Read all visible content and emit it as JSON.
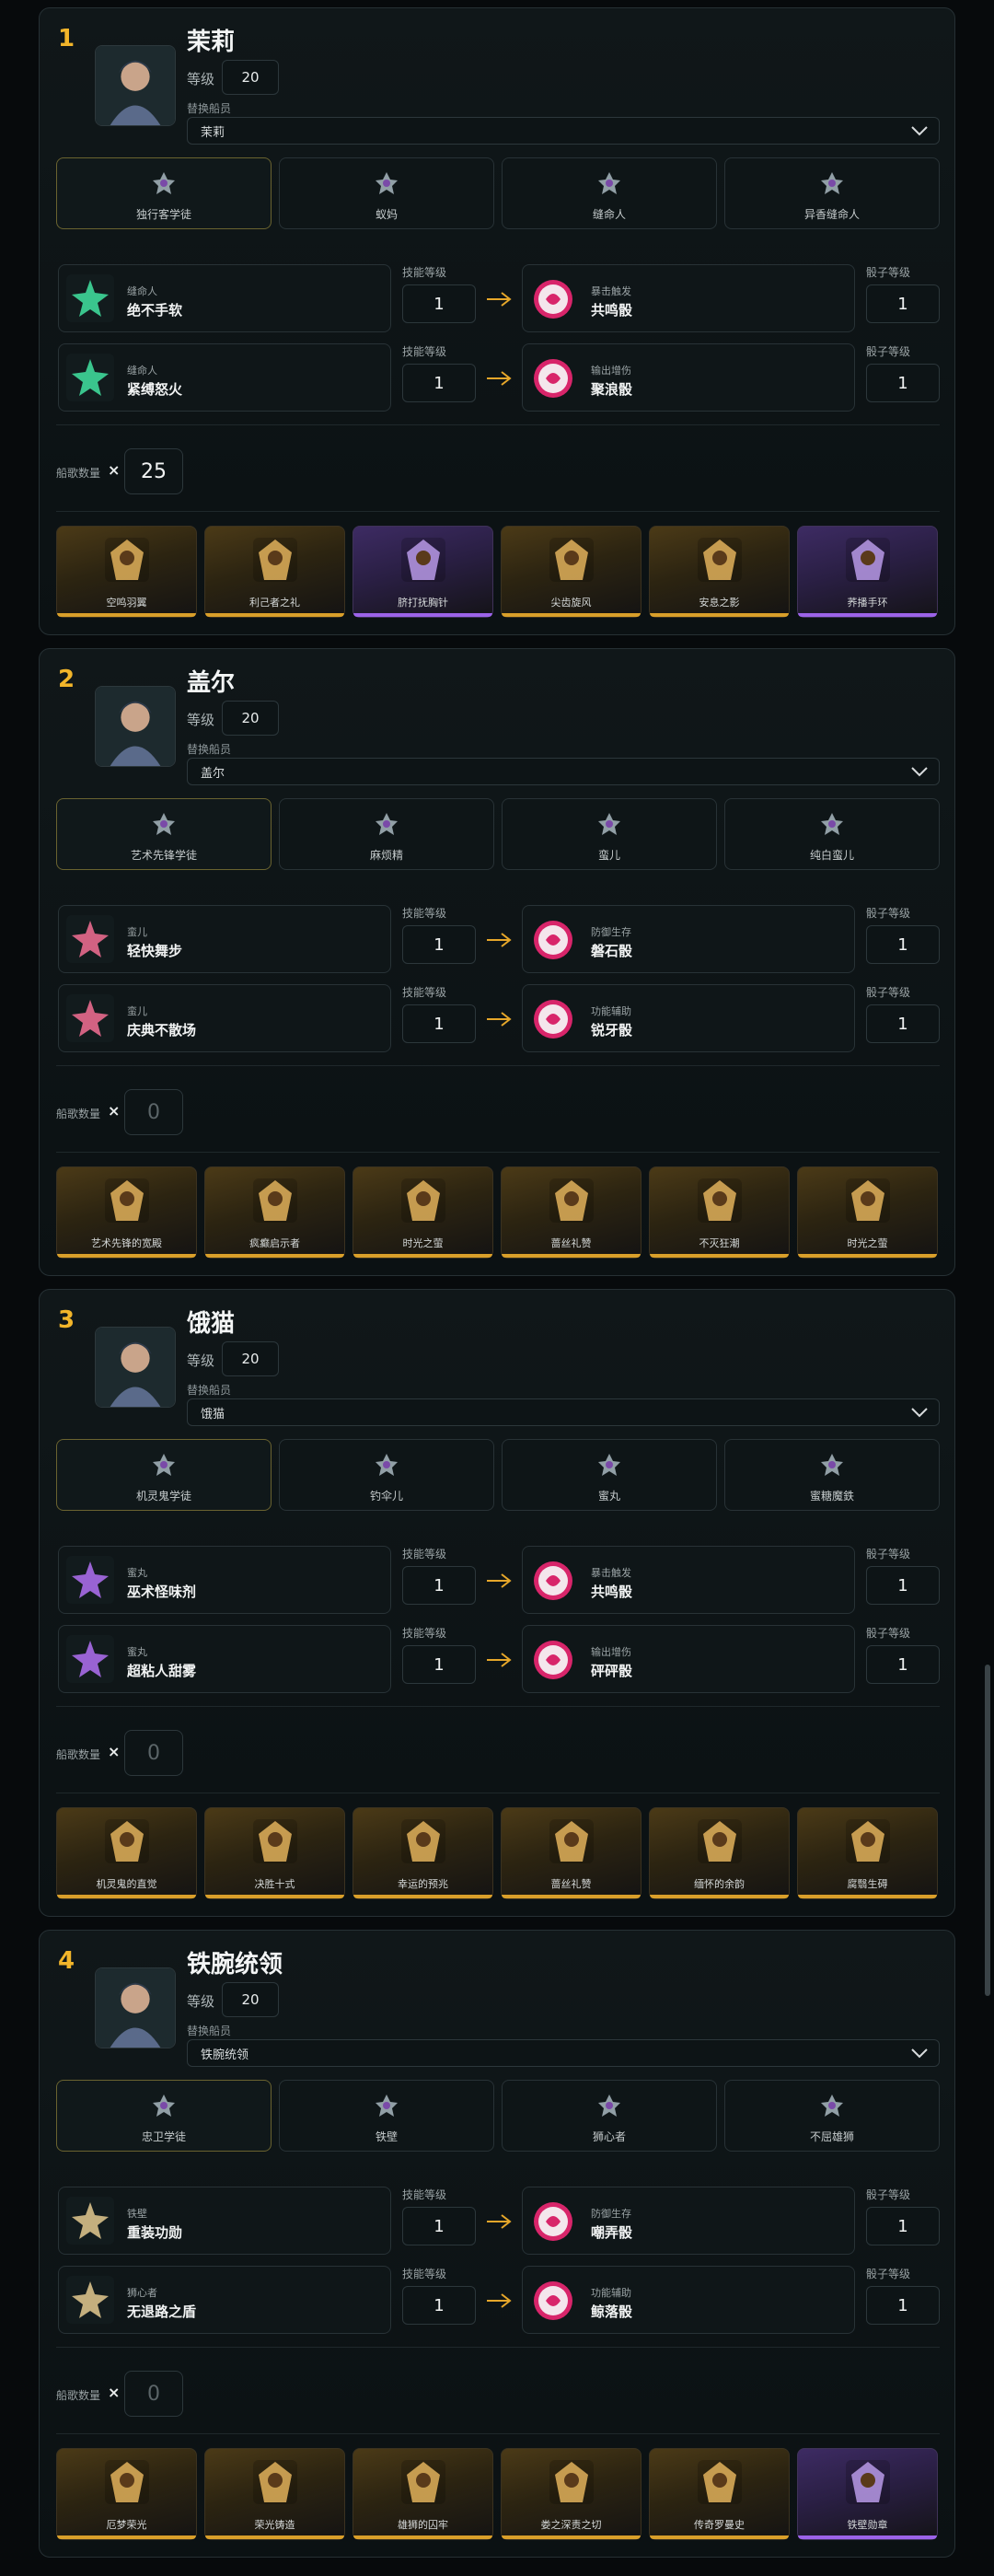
{
  "labels": {
    "level": "等级",
    "swap": "替换船员",
    "skill_level": "技能等级",
    "dice_level": "骰子等级",
    "tune_count": "船歌数量",
    "times": "×"
  },
  "colors": {
    "accent_gold": "#f2b52a",
    "gold_bar": "#d99f2a",
    "purple_bar": "#9c63e8",
    "dice_pink": "#d8256a"
  },
  "cards": [
    {
      "index": "1",
      "name": "茉莉",
      "level": "20",
      "swap_value": "茉莉",
      "tabs": [
        "独行客学徒",
        "蚁妈",
        "缝命人",
        "异香缝命人"
      ],
      "active_tab": 0,
      "skills": [
        {
          "type": "缝命人",
          "name": "绝不手软",
          "skill_level": "1",
          "dice_type": "暴击触发",
          "dice_name": "共鸣骰",
          "dice_level": "1",
          "icon": "green-star-icon",
          "dice_icon": "spiral-dice-icon"
        },
        {
          "type": "缝命人",
          "name": "紧缚怒火",
          "skill_level": "1",
          "dice_type": "输出增伤",
          "dice_name": "聚浪骰",
          "dice_level": "1",
          "icon": "green-star-icon",
          "dice_icon": "wave-dice-icon"
        }
      ],
      "tune_count": "25",
      "tune_filled": true,
      "items": [
        {
          "label": "空鸣羽翼",
          "rarity": "gold",
          "icon": "wing-icon"
        },
        {
          "label": "利己者之礼",
          "rarity": "gold",
          "icon": "helmet-icon"
        },
        {
          "label": "脐打抚胸针",
          "rarity": "purple",
          "icon": "brooch-icon"
        },
        {
          "label": "尖齿旋风",
          "rarity": "gold",
          "icon": "claw-icon"
        },
        {
          "label": "安息之影",
          "rarity": "gold",
          "icon": "mask-icon"
        },
        {
          "label": "荞播手环",
          "rarity": "purple",
          "icon": "bracelet-icon"
        }
      ]
    },
    {
      "index": "2",
      "name": "盖尔",
      "level": "20",
      "swap_value": "盖尔",
      "tabs": [
        "艺术先锋学徒",
        "麻烦精",
        "蛮儿",
        "纯白蛮儿"
      ],
      "active_tab": 0,
      "skills": [
        {
          "type": "蛮儿",
          "name": "轻快舞步",
          "skill_level": "1",
          "dice_type": "防御生存",
          "dice_name": "磐石骰",
          "dice_level": "1",
          "icon": "pink-swirl-icon",
          "dice_icon": "rock-dice-icon"
        },
        {
          "type": "蛮儿",
          "name": "庆典不散场",
          "skill_level": "1",
          "dice_type": "功能辅助",
          "dice_name": "锐牙骰",
          "dice_level": "1",
          "icon": "pink-swirl-icon",
          "dice_icon": "fang-dice-icon"
        }
      ],
      "tune_count": "0",
      "tune_filled": false,
      "items": [
        {
          "label": "艺术先锋的宽殿",
          "rarity": "gold",
          "icon": "angel-icon"
        },
        {
          "label": "疯癫启示者",
          "rarity": "gold",
          "icon": "ship-icon"
        },
        {
          "label": "时光之萤",
          "rarity": "gold",
          "icon": "compass-icon"
        },
        {
          "label": "蔷丝礼赞",
          "rarity": "gold",
          "icon": "cloak-icon"
        },
        {
          "label": "不灭狂潮",
          "rarity": "gold",
          "icon": "beast-icon"
        },
        {
          "label": "时光之萤",
          "rarity": "gold",
          "icon": "compass-icon"
        }
      ]
    },
    {
      "index": "3",
      "name": "饿猫",
      "level": "20",
      "swap_value": "饿猫",
      "tabs": [
        "机灵鬼学徒",
        "钓伞儿",
        "蜜丸",
        "蜜糖魔鉄"
      ],
      "active_tab": 0,
      "skills": [
        {
          "type": "蜜丸",
          "name": "巫术怪味剂",
          "skill_level": "1",
          "dice_type": "暴击触发",
          "dice_name": "共鸣骰",
          "dice_level": "1",
          "icon": "purple-gear-icon",
          "dice_icon": "spiral-dice-icon"
        },
        {
          "type": "蜜丸",
          "name": "超粘人甜雾",
          "skill_level": "1",
          "dice_type": "输出增伤",
          "dice_name": "砰砰骰",
          "dice_level": "1",
          "icon": "purple-wand-icon",
          "dice_icon": "burst-dice-icon"
        }
      ],
      "tune_count": "0",
      "tune_filled": false,
      "items": [
        {
          "label": "机灵鬼的直觉",
          "rarity": "gold",
          "icon": "gun-icon"
        },
        {
          "label": "决胜十式",
          "rarity": "gold",
          "icon": "helmet-icon"
        },
        {
          "label": "幸运的预兆",
          "rarity": "gold",
          "icon": "bag-icon"
        },
        {
          "label": "蔷丝礼赞",
          "rarity": "gold",
          "icon": "cloak-icon"
        },
        {
          "label": "缅怀的余韵",
          "rarity": "gold",
          "icon": "figure-icon"
        },
        {
          "label": "腐翳生碍",
          "rarity": "gold",
          "icon": "leaf-icon"
        }
      ]
    },
    {
      "index": "4",
      "name": "铁腕统领",
      "level": "20",
      "swap_value": "铁腕统领",
      "tabs": [
        "忠卫学徒",
        "铁壁",
        "狮心者",
        "不屈雄狮"
      ],
      "active_tab": 0,
      "skills": [
        {
          "type": "铁壁",
          "name": "重装功勋",
          "skill_level": "1",
          "dice_type": "防御生存",
          "dice_name": "嘲弄骰",
          "dice_level": "1",
          "icon": "shield-hand-icon",
          "dice_icon": "taunt-dice-icon"
        },
        {
          "type": "狮心者",
          "name": "无退路之盾",
          "skill_level": "1",
          "dice_type": "功能辅助",
          "dice_name": "鲸落骰",
          "dice_level": "1",
          "icon": "handshake-icon",
          "dice_icon": "whale-dice-icon"
        }
      ],
      "tune_count": "0",
      "tune_filled": false,
      "items": [
        {
          "label": "厄梦荣光",
          "rarity": "gold",
          "icon": "cross-icon"
        },
        {
          "label": "荣光铸造",
          "rarity": "gold",
          "icon": "helmet-icon"
        },
        {
          "label": "雄狮的囚牢",
          "rarity": "gold",
          "icon": "lion-icon"
        },
        {
          "label": "娄之深责之切",
          "rarity": "gold",
          "icon": "sword-icon"
        },
        {
          "label": "传奇罗曼史",
          "rarity": "gold",
          "icon": "figure-icon"
        },
        {
          "label": "铁壁勋章",
          "rarity": "purple",
          "icon": "medal-icon"
        }
      ]
    }
  ]
}
